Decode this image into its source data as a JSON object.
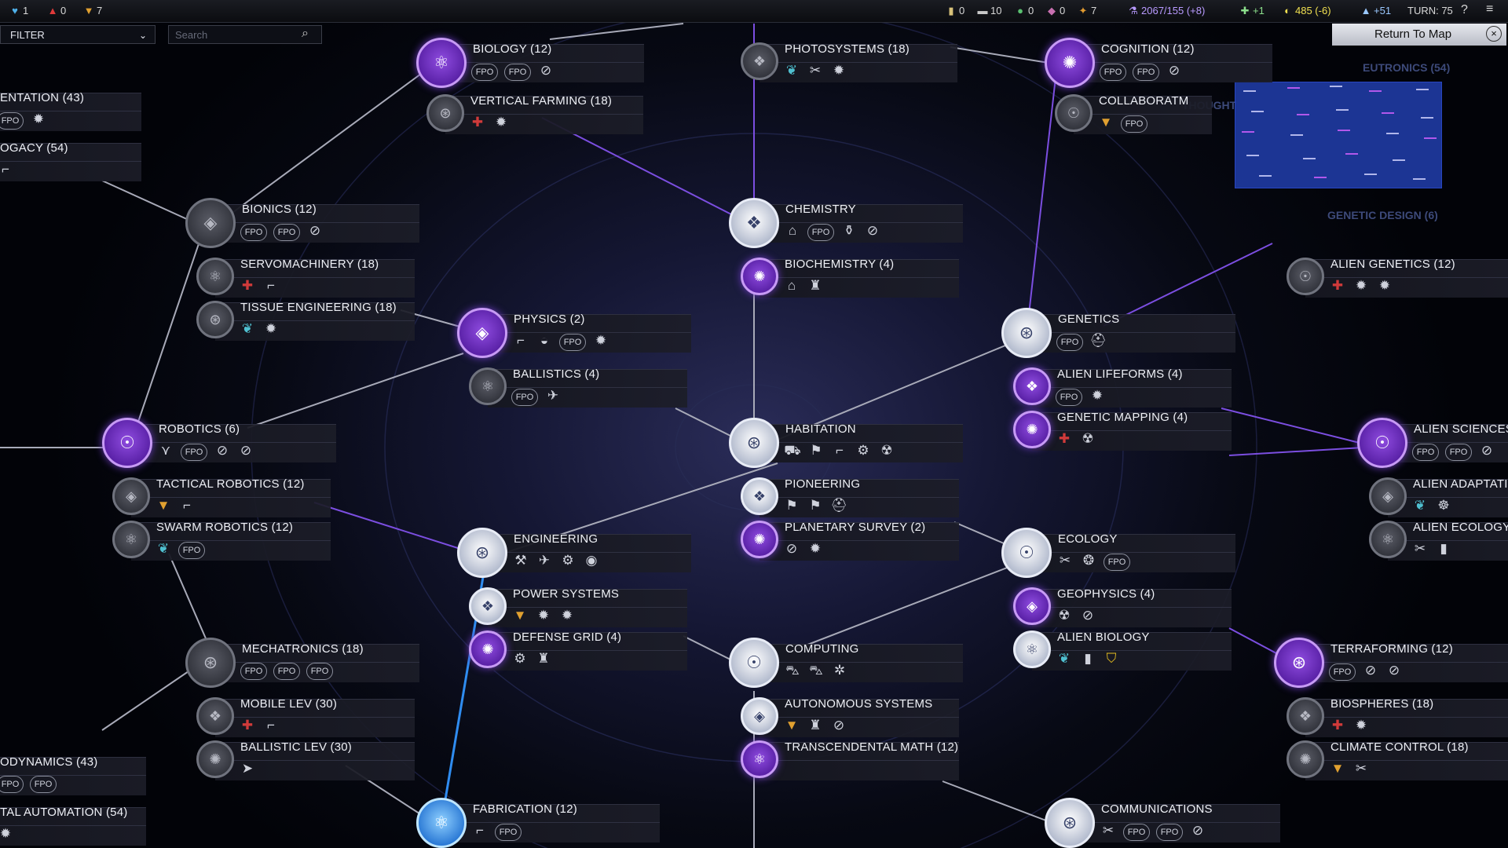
{
  "topbar": {
    "health": "1",
    "unrest": "0",
    "affinity": "7",
    "resources": [
      "0",
      "10",
      "0",
      "0",
      "7"
    ],
    "science": "2067/155 (+8)",
    "food": "+1",
    "energy": "485 (-6)",
    "culture": "+51",
    "turn": "TURN: 75"
  },
  "controls": {
    "filter_label": "FILTER",
    "search_placeholder": "Search",
    "return_label": "Return To Map"
  },
  "ghosts": {
    "eutronics": "EUTRONICS (54)",
    "genetic_design": "GENETIC DESIGN (6)",
    "thought": "THOUGHT"
  },
  "techs": {
    "implementation": {
      "name": "ENTATION (43)",
      "units": [
        "FPO",
        "gear"
      ]
    },
    "biogacy": {
      "name": "OGACY (54)",
      "units": [
        "gun"
      ]
    },
    "biology": {
      "name": "BIOLOGY (12)",
      "units": [
        "FPO",
        "FPO",
        "wonder"
      ]
    },
    "vertical_farming": {
      "name": "VERTICAL FARMING (18)",
      "units": [
        "health",
        "gear"
      ]
    },
    "photosystems": {
      "name": "PHOTOSYSTEMS (18)",
      "units": [
        "seed",
        "tool",
        "gear"
      ]
    },
    "cognition": {
      "name": "COGNITION (12)",
      "units": [
        "FPO",
        "FPO",
        "wonder"
      ]
    },
    "collaboration": {
      "name": "COLLABORATM",
      "units": [
        "affinity",
        "FPO"
      ]
    },
    "bionics": {
      "name": "BIONICS (12)",
      "units": [
        "FPO",
        "FPO",
        "wonder"
      ]
    },
    "servomachinery": {
      "name": "SERVOMACHINERY (18)",
      "units": [
        "health",
        "gun"
      ]
    },
    "tissue_engineering": {
      "name": "TISSUE ENGINEERING (18)",
      "units": [
        "seed",
        "gear"
      ]
    },
    "chemistry": {
      "name": "CHEMISTRY",
      "units": [
        "building",
        "FPO",
        "flask",
        "wonder"
      ]
    },
    "biochemistry": {
      "name": "BIOCHEMISTRY (4)",
      "units": [
        "building",
        "tower"
      ]
    },
    "alien_genetics": {
      "name": "ALIEN GENETICS (12)",
      "units": [
        "health",
        "gear",
        "gear"
      ]
    },
    "physics": {
      "name": "PHYSICS (2)",
      "units": [
        "gun",
        "dome",
        "FPO",
        "gear"
      ]
    },
    "ballistics": {
      "name": "BALLISTICS (4)",
      "units": [
        "FPO",
        "drone"
      ]
    },
    "genetics": {
      "name": "GENETICS",
      "units": [
        "FPO",
        "helmet"
      ]
    },
    "alien_lifeforms": {
      "name": "ALIEN LIFEFORMS (4)",
      "units": [
        "FPO",
        "gear"
      ]
    },
    "genetic_mapping": {
      "name": "GENETIC MAPPING (4)",
      "units": [
        "health",
        "creature"
      ]
    },
    "robotics": {
      "name": "ROBOTICS (6)",
      "units": [
        "wings",
        "FPO",
        "wonder",
        "wonder"
      ]
    },
    "tactical_robotics": {
      "name": "TACTICAL ROBOTICS (12)",
      "units": [
        "affinity",
        "gun"
      ]
    },
    "swarm_robotics": {
      "name": "SWARM ROBOTICS (12)",
      "units": [
        "seed",
        "FPO"
      ]
    },
    "habitation": {
      "name": "HABITATION",
      "units": [
        "colonist",
        "flag",
        "gun",
        "robot",
        "creature"
      ]
    },
    "pioneering": {
      "name": "PIONEERING",
      "units": [
        "flag",
        "flag",
        "helmet"
      ]
    },
    "planetary_survey": {
      "name": "PLANETARY SURVEY (2)",
      "units": [
        "wonder",
        "gear"
      ]
    },
    "alien_sciences": {
      "name": "ALIEN SCIENCES",
      "units": [
        "FPO",
        "FPO",
        "wonder"
      ]
    },
    "alien_adaptation": {
      "name": "ALIEN ADAPTATI",
      "units": [
        "seed",
        "brain"
      ]
    },
    "alien_ecology": {
      "name": "ALIEN ECOLOGY",
      "units": [
        "tool",
        "canister"
      ]
    },
    "engineering": {
      "name": "ENGINEERING",
      "units": [
        "tools",
        "drone",
        "robot",
        "pod"
      ]
    },
    "power_systems": {
      "name": "POWER SYSTEMS",
      "units": [
        "affinity",
        "gear",
        "gear"
      ]
    },
    "defense_grid": {
      "name": "DEFENSE GRID (4)",
      "units": [
        "robot",
        "tower"
      ]
    },
    "ecology": {
      "name": "ECOLOGY",
      "units": [
        "tool",
        "shell",
        "FPO"
      ]
    },
    "geophysics": {
      "name": "GEOPHYSICS (4)",
      "units": [
        "creature",
        "wonder"
      ]
    },
    "alien_biology": {
      "name": "ALIEN BIOLOGY",
      "units": [
        "seed",
        "canister",
        "shield"
      ]
    },
    "mechatronics": {
      "name": "MECHATRONICS (18)",
      "units": [
        "FPO",
        "FPO",
        "FPO"
      ]
    },
    "mobile_lev": {
      "name": "MOBILE LEV (30)",
      "units": [
        "health",
        "gun"
      ]
    },
    "ballistic_lev": {
      "name": "BALLISTIC LEV (30)",
      "units": [
        "jet"
      ]
    },
    "computing": {
      "name": "COMPUTING",
      "units": [
        "tank",
        "tank",
        "satellite"
      ]
    },
    "autonomous_systems": {
      "name": "AUTONOMOUS SYSTEMS",
      "units": [
        "affinity",
        "tower",
        "wonder"
      ]
    },
    "transcendental_math": {
      "name": "TRANSCENDENTAL MATH (12)",
      "units": []
    },
    "terraforming": {
      "name": "TERRAFORMING (12)",
      "units": [
        "FPO",
        "wonder",
        "wonder"
      ]
    },
    "biospheres": {
      "name": "BIOSPHERES (18)",
      "units": [
        "health",
        "gear"
      ]
    },
    "climate_control": {
      "name": "CLIMATE CONTROL (18)",
      "units": [
        "affinity",
        "tool"
      ]
    },
    "aerodynamics": {
      "name": "ODYNAMICS (43)",
      "units": [
        "FPO",
        "FPO"
      ]
    },
    "orbital_automation": {
      "name": "TAL AUTOMATION (54)",
      "units": [
        "gear"
      ]
    },
    "fabrication": {
      "name": "FABRICATION (12)",
      "units": [
        "gun",
        "FPO"
      ]
    },
    "communications": {
      "name": "COMMUNICATIONS",
      "units": [
        "tool",
        "FPO",
        "FPO",
        "wonder"
      ]
    }
  },
  "colors": {
    "purple_line": "#7b4ee0",
    "grey_line": "#a8aab8",
    "blue_line": "#2f8cf0",
    "accent_purple": "#8f4ce0"
  }
}
